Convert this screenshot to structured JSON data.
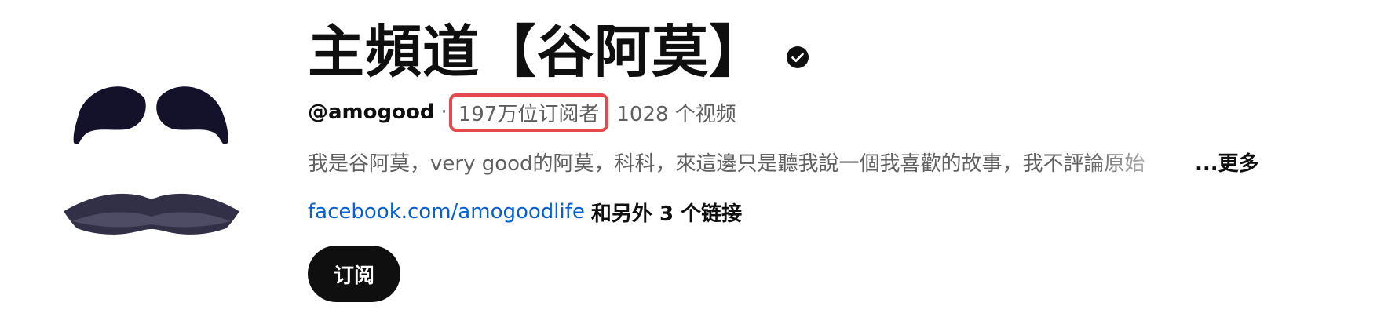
{
  "channel": {
    "title": "主頻道【谷阿莫】",
    "verified_icon": "verified-check-icon",
    "handle": "@amogood",
    "separator": "·",
    "subscribers": "197万位订阅者",
    "videos": "1028 个视频",
    "description": "我是谷阿莫，very good的阿莫，科科，來這邊只是聽我說一個我喜歡的故事，我不評論原始",
    "more_label": "...更多",
    "link_text": "facebook.com/amogoodlife",
    "other_links": "和另外 3 个链接",
    "subscribe_label": "订阅"
  },
  "colors": {
    "text_primary": "#0f0f0f",
    "text_secondary": "#606060",
    "link": "#065fd4",
    "highlight_box": "#e5484d",
    "subscribe_bg": "#0f0f0f"
  }
}
